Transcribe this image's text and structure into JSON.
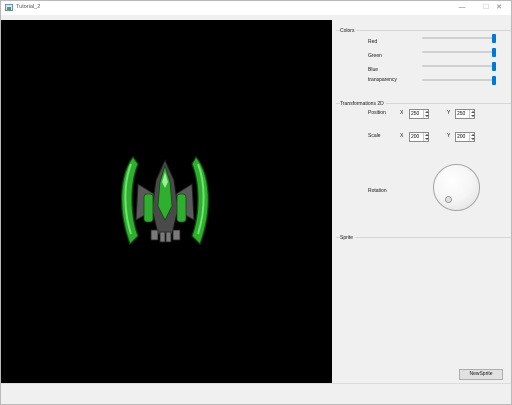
{
  "window": {
    "title": "Tutorial_2"
  },
  "colors": {
    "title": "Colors",
    "red_label": "Red",
    "green_label": "Green",
    "blue_label": "Blue",
    "transparency_label": "transparency",
    "red_value": 1.0,
    "green_value": 1.0,
    "blue_value": 1.0,
    "transparency_value": 1.0
  },
  "transform": {
    "title": "Transformations 2D",
    "position_label": "Position",
    "scale_label": "Scale",
    "rotation_label": "Rotation",
    "x_label": "X",
    "y_label": "Y",
    "position_x": "250",
    "position_y": "250",
    "scale_x": "200",
    "scale_y": "200"
  },
  "sprite": {
    "title": "Sprite",
    "new_sprite_label": "NewSprite"
  },
  "theme": {
    "accent": "#0078d7",
    "viewport_bg": "#000000",
    "ship_green": "#2fae2f",
    "ship_grey": "#6b6b6b"
  }
}
